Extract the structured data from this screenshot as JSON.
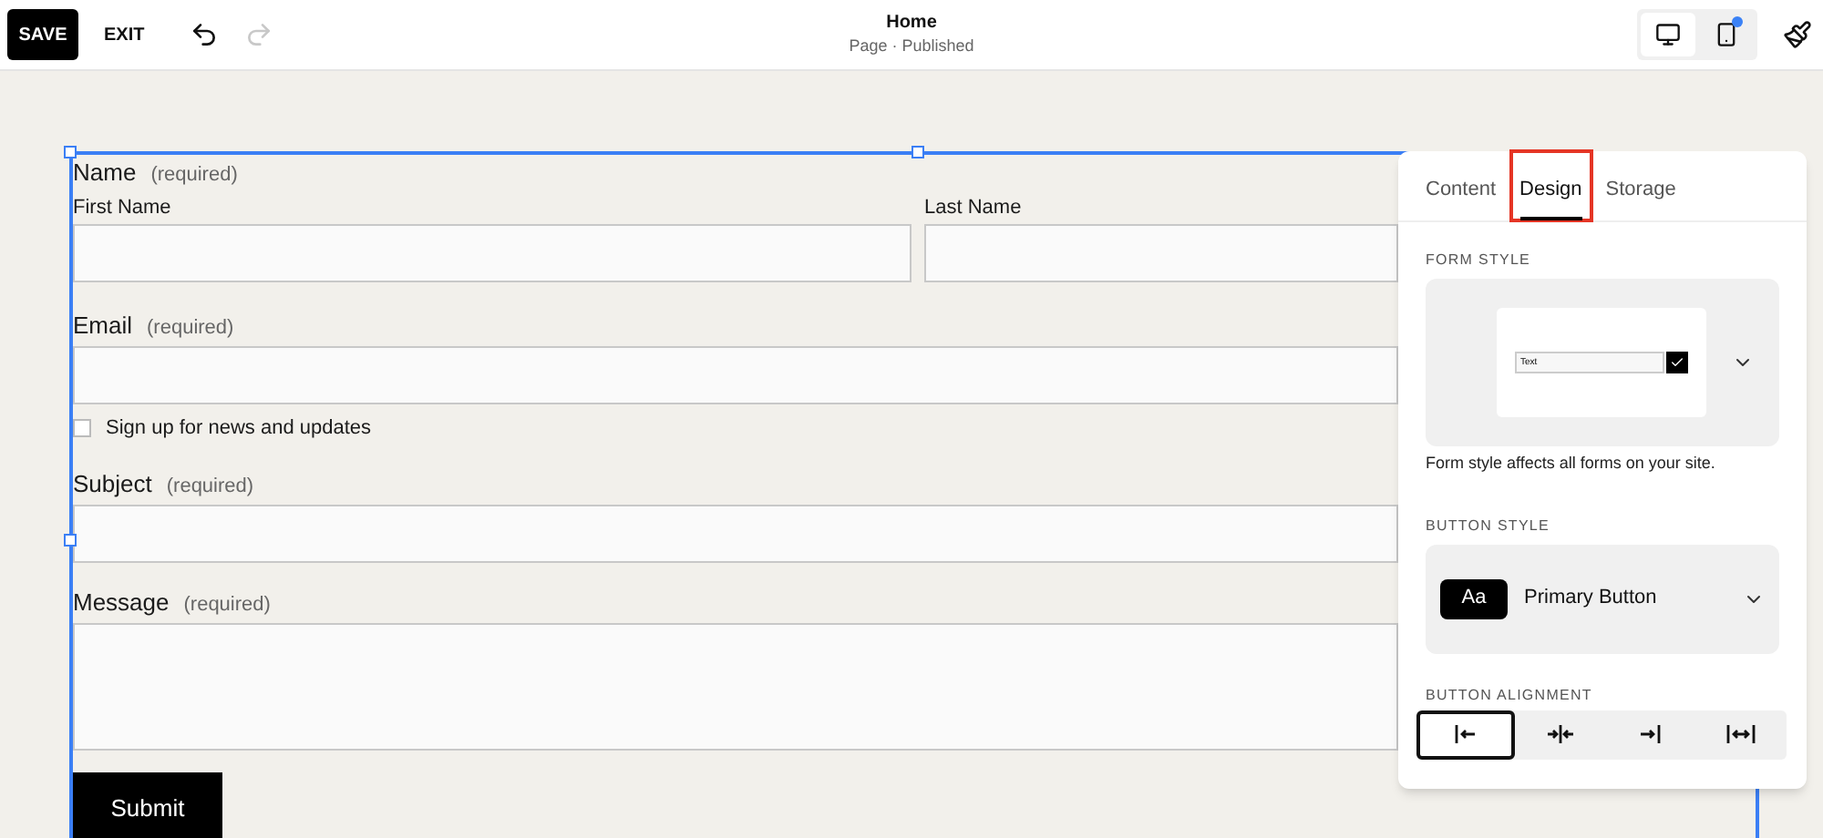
{
  "toolbar": {
    "save": "SAVE",
    "exit": "EXIT",
    "undo": {
      "disabled": false
    },
    "redo": {
      "disabled": true
    },
    "title": "Home",
    "subtitle": "Page · Published",
    "devices": [
      {
        "kind": "desktop",
        "selected": true,
        "badge": false
      },
      {
        "kind": "mobile",
        "selected": false,
        "badge": true
      }
    ]
  },
  "form": {
    "name": {
      "label": "Name",
      "note": "(required)",
      "fields": [
        {
          "label": "First Name"
        },
        {
          "label": "Last Name"
        }
      ]
    },
    "email": {
      "label": "Email",
      "note": "(required)"
    },
    "signup": {
      "label": "Sign up for news and updates",
      "checked": false
    },
    "subject": {
      "label": "Subject",
      "note": "(required)"
    },
    "message": {
      "label": "Message",
      "note": "(required)"
    },
    "submit": "Submit"
  },
  "panel": {
    "tabs": [
      {
        "label": "Content",
        "selected": false,
        "highlighted": false
      },
      {
        "label": "Design",
        "selected": true,
        "highlighted": true
      },
      {
        "label": "Storage",
        "selected": false,
        "highlighted": false
      }
    ],
    "form_style": {
      "heading": "FORM STYLE",
      "preview_text": "Text",
      "preview_checked": true,
      "caption": "Form style affects all forms on your site."
    },
    "button_style": {
      "heading": "BUTTON STYLE",
      "swatch": "Aa",
      "value": "Primary Button"
    },
    "button_alignment": {
      "heading": "BUTTON ALIGNMENT",
      "options": [
        {
          "kind": "left",
          "selected": true
        },
        {
          "kind": "center",
          "selected": false
        },
        {
          "kind": "right",
          "selected": false
        },
        {
          "kind": "full",
          "selected": false
        }
      ]
    }
  }
}
